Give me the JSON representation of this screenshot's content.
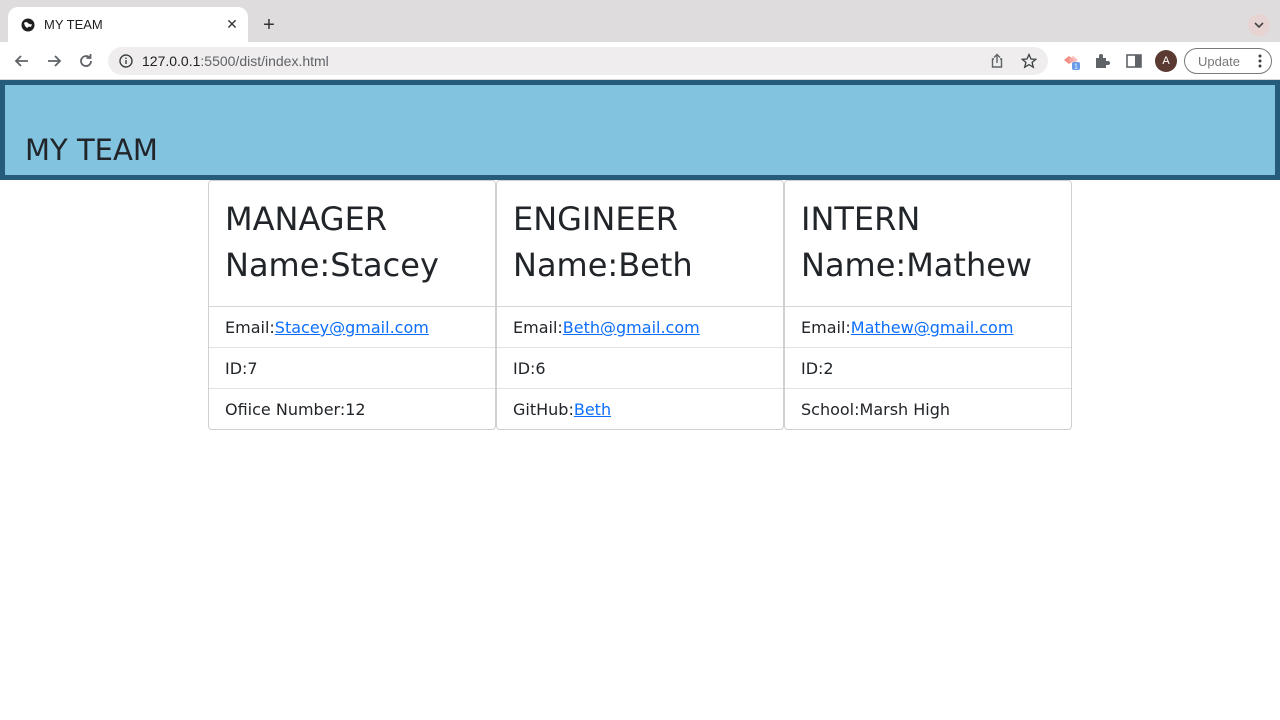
{
  "browser": {
    "tab_title": "MY TEAM",
    "url_host": "127.0.0.1",
    "url_rest": ":5500/dist/index.html",
    "avatar_letter": "A",
    "update_label": "Update",
    "extension_badge": "1"
  },
  "page": {
    "header_title": "MY TEAM",
    "cards": [
      {
        "role": "MANAGER",
        "name": "Name:Stacey",
        "email_label": "Email:",
        "email": "Stacey@gmail.com",
        "id": "ID:7",
        "extra_label": "Ofiice Number:12",
        "extra_link": ""
      },
      {
        "role": "ENGINEER",
        "name": "Name:Beth",
        "email_label": "Email:",
        "email": "Beth@gmail.com",
        "id": "ID:6",
        "extra_label": "GitHub:",
        "extra_link": "Beth"
      },
      {
        "role": "INTERN",
        "name": "Name:Mathew",
        "email_label": "Email:",
        "email": "Mathew@gmail.com",
        "id": "ID:2",
        "extra_label": "School:Marsh High",
        "extra_link": ""
      }
    ]
  },
  "colors": {
    "header_bg": "#82c3e0",
    "header_border": "#265b7c",
    "link": "#0d6efd"
  }
}
